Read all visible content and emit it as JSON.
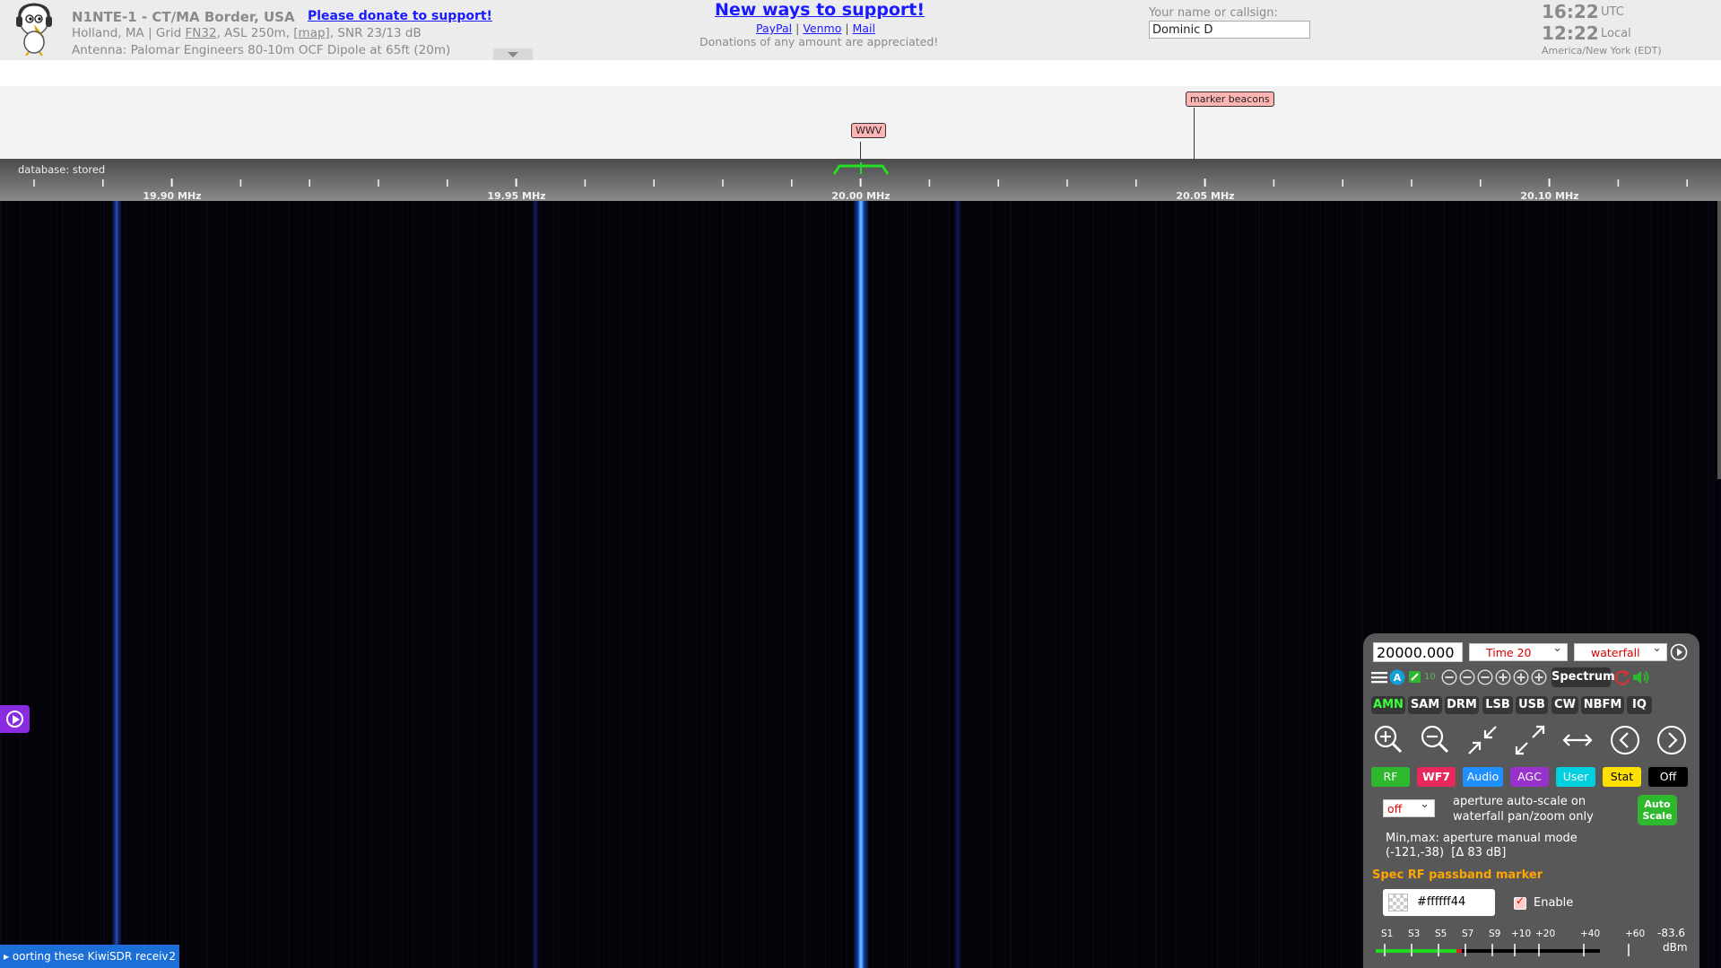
{
  "header": {
    "station_title": "N1NTE-1 - CT/MA Border, USA",
    "donate_link": "Please donate to support!",
    "location_prefix": "Holland, MA | Grid ",
    "grid": "FN32",
    "location_mid": ", ASL 250m, ",
    "map_link": "[map]",
    "snr": ", SNR 23/13 dB",
    "antenna": "Antenna: Palomar Engineers 80-10m OCF Dipole at 65ft (20m)"
  },
  "support": {
    "title": "New ways to support!",
    "paypal": "PayPal",
    "venmo": "Venmo",
    "mail": "Mail",
    "separator": " | ",
    "note": "Donations of any amount are appreciated!"
  },
  "callsign": {
    "label": "Your name or callsign:",
    "value": "Dominic D"
  },
  "clock": {
    "utc_time": "16:22",
    "utc_label": "UTC",
    "local_time": "12:22",
    "local_label": "Local",
    "timezone": "America/New York (EDT)"
  },
  "dx_labels": [
    {
      "text": "WWV"
    },
    {
      "text": "marker beacons"
    }
  ],
  "database_label": "database: stored",
  "scale": {
    "labels": [
      "19.90 MHz",
      "19.95 MHz",
      "20.00 MHz",
      "20.05 MHz",
      "20.10 MHz"
    ]
  },
  "ticker": {
    "text": "oorting these KiwiSDR receiv",
    "count": "2"
  },
  "panel": {
    "frequency": "20000.000",
    "time_select": "Time 20",
    "view_select": "waterfall",
    "small_num": "10",
    "spectrum_btn": "Spectrum",
    "modes": [
      "AMN",
      "SAM",
      "DRM",
      "LSB",
      "USB",
      "CW",
      "NBFM",
      "IQ"
    ],
    "active_mode": "AMN",
    "tabs": [
      "RF",
      "WF7",
      "Audio",
      "AGC",
      "User",
      "Stat",
      "Off"
    ],
    "tab_colors": [
      "#2eb82e",
      "#e8285a",
      "#1e90ff",
      "#9932cc",
      "#00d0e0",
      "#ffe000",
      "#000000"
    ],
    "aperture_select": "off",
    "aperture_text1": "aperture auto-scale on",
    "aperture_text2": "waterfall pan/zoom only",
    "auto_scale_label1": "Auto",
    "auto_scale_label2": "Scale",
    "minmax_text": "Min,max: aperture manual mode",
    "minmax_values": "(-121,-38)  [Δ 83 dB]",
    "marker_title": "Spec RF passband marker",
    "marker_color": "#ffffff44",
    "enable_label": "Enable",
    "smeter_labels": [
      "S1",
      "S3",
      "S5",
      "S7",
      "S9",
      "+10",
      "+20",
      "+40",
      "+60"
    ],
    "smeter_value": "-83.6",
    "smeter_unit": "dBm"
  }
}
